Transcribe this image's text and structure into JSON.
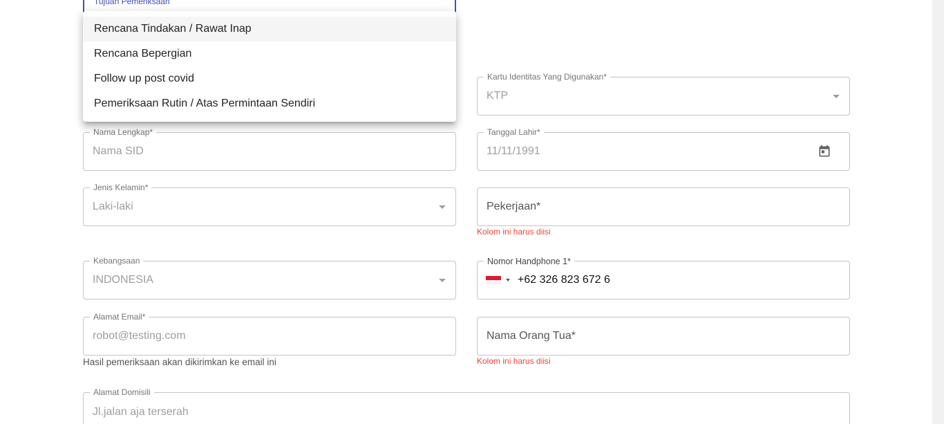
{
  "tujuan": {
    "label": "Tujuan Pemeriksaan"
  },
  "dropdown": {
    "options": [
      "Rencana Tindakan / Rawat Inap",
      "Rencana Bepergian",
      "Follow up post covid",
      "Pemeriksaan Rutin / Atas Permintaan Sendiri"
    ]
  },
  "kartu": {
    "label": "Kartu Identitas Yang Digunakan*",
    "value": "KTP"
  },
  "nama": {
    "label": "Nama Lengkap*",
    "value": "Nama SID"
  },
  "tanggal": {
    "label": "Tanggal Lahir*",
    "value": "11/11/1991",
    "icon": "calendar-icon"
  },
  "jenis": {
    "label": "Jenis Kelamin*",
    "value": "Laki-laki"
  },
  "pekerjaan": {
    "placeholder": "Pekerjaan*",
    "error": "Kolom ini harus diisi"
  },
  "kebangsaan": {
    "label": "Kebangsaan",
    "value": "INDONESIA"
  },
  "phone": {
    "label": "Nomor Handphone 1*",
    "value": "+62 326 823 672 6",
    "flag": "indonesia-flag-icon"
  },
  "email": {
    "label": "Alamat Email*",
    "value": "robot@testing.com",
    "helper": "Hasil pemeriksaan akan dikirimkan ke email ini"
  },
  "orangtua": {
    "placeholder": "Nama Orang Tua*",
    "error": "Kolom ini harus diisi"
  },
  "domisili": {
    "label": "Alamat Domisili",
    "value": "Jl.jalan aja terserah"
  },
  "colors": {
    "accent": "#3f51b5",
    "error": "#f44336",
    "border": "#c4c4c4"
  }
}
